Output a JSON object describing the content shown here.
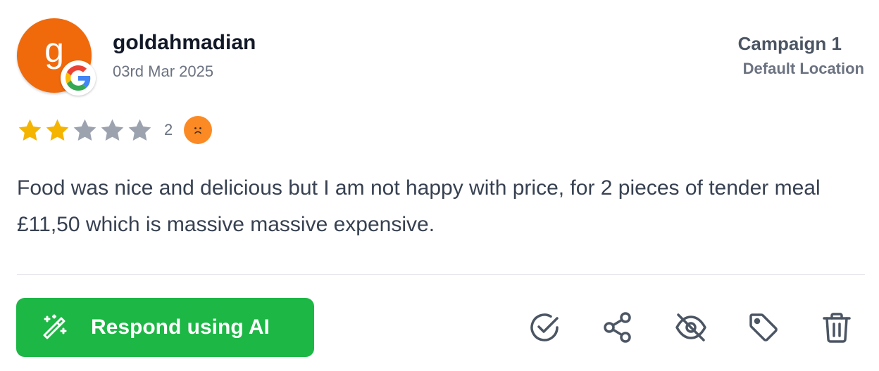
{
  "review": {
    "avatar_letter": "g",
    "avatar_color": "#f06a0c",
    "source_icon": "google-icon",
    "user_name": "goldahmadian",
    "date": "03rd Mar 2025",
    "campaign": "Campaign 1",
    "location": "Default Location",
    "rating": 2,
    "rating_max": 5,
    "rating_label": "2",
    "sentiment_icon": "sad-face-icon",
    "text": "Food was nice and delicious but I am not happy with price, for 2 pieces of tender meal £11,50 which is massive massive expensive."
  },
  "actions": {
    "respond_label": "Respond using AI",
    "respond_icon": "magic-wand-icon",
    "icons": [
      "check-circle-icon",
      "share-icon",
      "eye-off-icon",
      "tag-icon",
      "trash-icon"
    ]
  },
  "colors": {
    "accent_green": "#1db745",
    "star_filled": "#f5b400",
    "star_empty": "#9ca3af",
    "sentiment": "#fb8a24"
  }
}
